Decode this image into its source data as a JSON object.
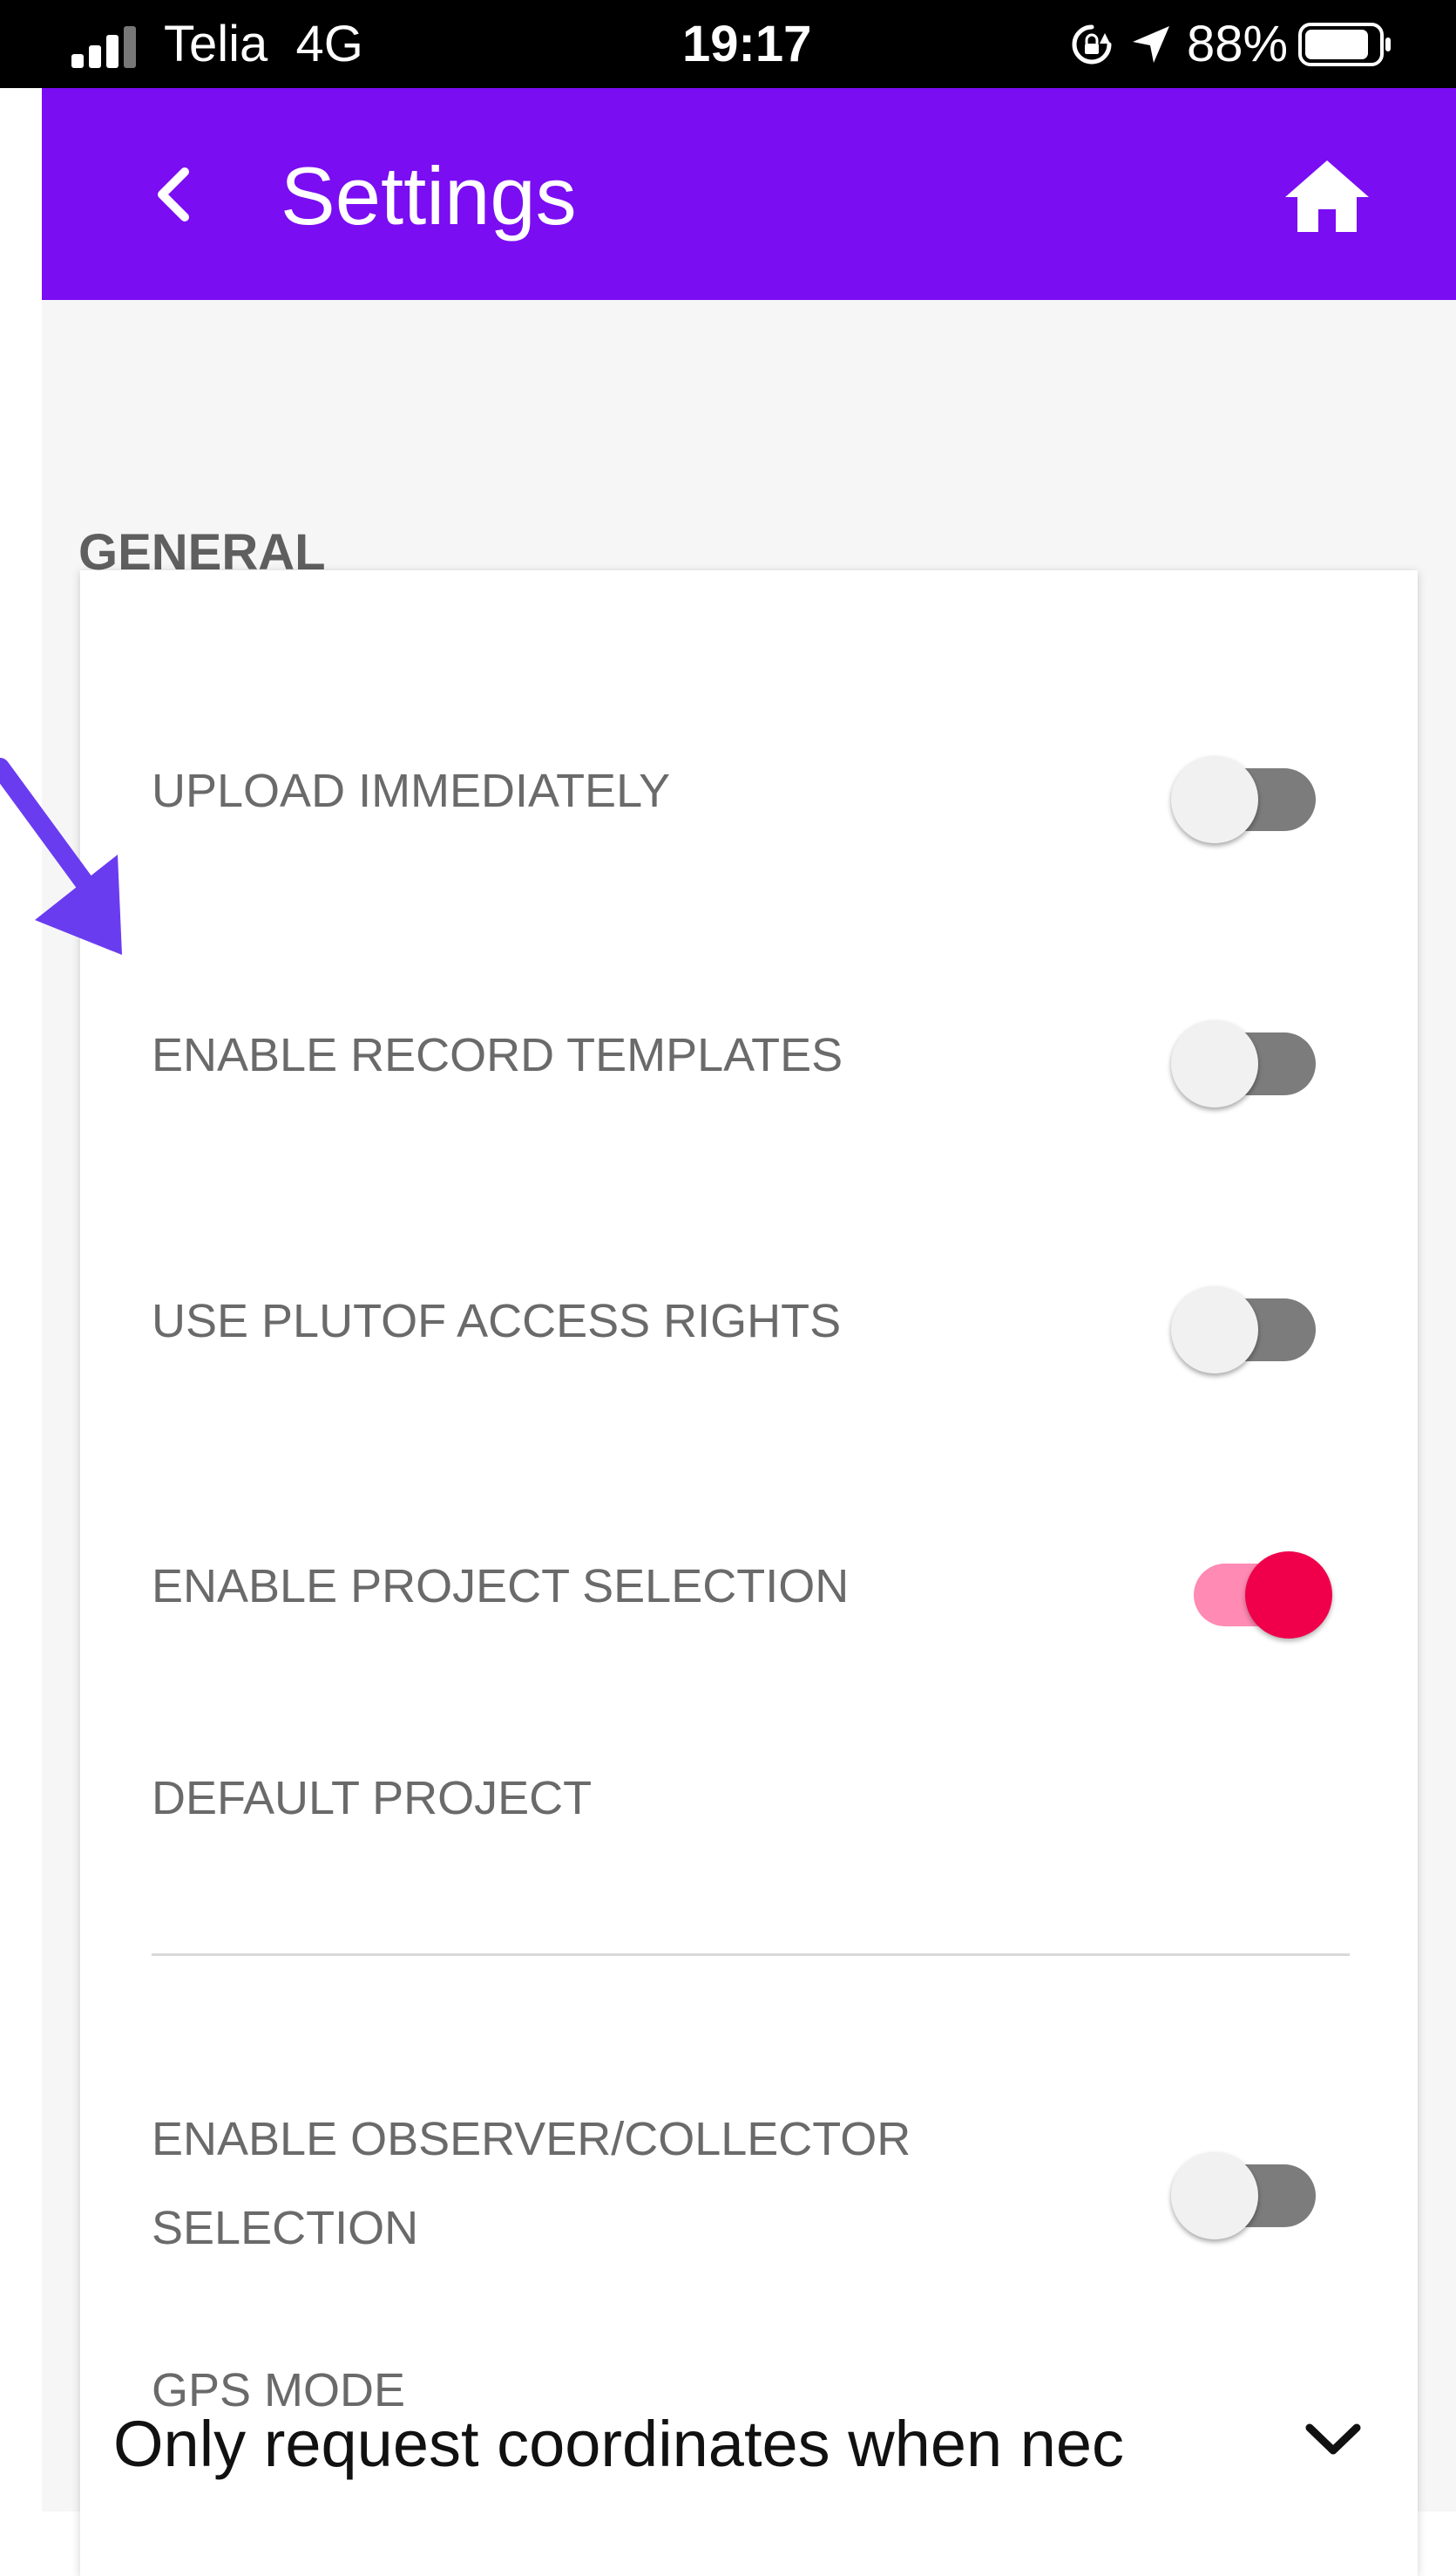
{
  "status_bar": {
    "carrier": "Telia",
    "network": "4G",
    "time": "19:17",
    "battery": "88%",
    "battery_level": 0.88
  },
  "app_bar": {
    "title": "Settings",
    "back_icon": "chevron-left-icon",
    "home_icon": "home-icon"
  },
  "general": {
    "header": "GENERAL",
    "settings": [
      {
        "label": "UPLOAD IMMEDIATELY",
        "enabled": false
      },
      {
        "label": "ENABLE RECORD TEMPLATES",
        "enabled": false
      },
      {
        "label": "USE PLUTOF ACCESS RIGHTS",
        "enabled": false
      },
      {
        "label": "ENABLE PROJECT SELECTION",
        "enabled": true
      }
    ],
    "default_project": {
      "label": "DEFAULT PROJECT",
      "value": ""
    },
    "observer_collector": {
      "label_line1": "ENABLE OBSERVER/COLLECTOR",
      "label_line2": "SELECTION",
      "enabled": false
    },
    "gps_mode": {
      "label": "GPS MODE",
      "value": "Only request coordinates when nec"
    }
  },
  "colors": {
    "app_bar": "#7a0df2",
    "toggle_on_knob": "#f0004b",
    "toggle_on_track": "#ff8ab3",
    "toggle_off_track": "#7c7c7c",
    "annotation_arrow": "#6a3cf0"
  }
}
